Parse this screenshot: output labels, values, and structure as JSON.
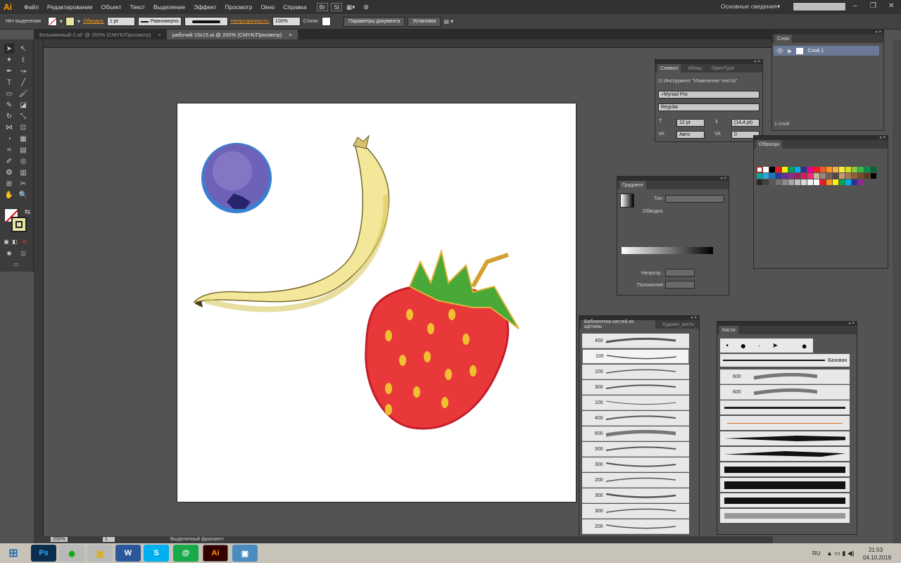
{
  "app": {
    "logo": "Ai",
    "workspace": "Основные сведения"
  },
  "menu": [
    "Файл",
    "Редактирование",
    "Объект",
    "Текст",
    "Выделение",
    "Эффект",
    "Просмотр",
    "Окно",
    "Справка"
  ],
  "menu_icons": [
    "Br",
    "St"
  ],
  "control_bar": {
    "selection_label": "Нет выделения",
    "stroke_label": "Обводка:",
    "stroke_weight": "1 pt",
    "profile": "Равномерно",
    "opacity_label": "Непрозрачность:",
    "opacity_value": "100%",
    "styles_label": "Стили:",
    "doc_params_button": "Параметры документа",
    "settings_button": "Установки"
  },
  "tabs": [
    {
      "label": "Безымянный-2.ai* @ 200% (CMYK/Просмотр)",
      "close": "×",
      "active": false
    },
    {
      "label": "рабочий 15х15.ai @ 200% (CMYK/Просмотр)",
      "close": "×",
      "active": true
    }
  ],
  "layers_panel": {
    "title": "Слои",
    "layer_name": "Слой 1",
    "footer": "1 слой"
  },
  "character_panel": {
    "tabs": [
      "Символ",
      "Абзац",
      "OpenType"
    ],
    "touch_tool": "Инструмент \"Изменение текста\"",
    "font_family": "Myriad Pro",
    "font_style": "Regular",
    "font_size": "12 pt",
    "leading": "(14,4 pt)",
    "kerning": "Авто",
    "tracking": "0"
  },
  "swatches_panel": {
    "title": "Образцы"
  },
  "gradient_panel": {
    "title": "Градиент",
    "type_label": "Тип:",
    "stroke_label": "Обводка:",
    "opacity_label": "Непрозр.:",
    "position_label": "Положение:"
  },
  "brush_library_panel": {
    "tabs": [
      "Библиотека кистей из щетины",
      "Художн_кисть"
    ],
    "rows": [
      "450",
      "100",
      "100",
      "300",
      "100",
      "400",
      "600",
      "300",
      "300",
      "200",
      "300",
      "300",
      "200"
    ]
  },
  "brushes_panel": {
    "title": "Кисти",
    "basic_label": "Базовая",
    "rows": [
      "600",
      "600"
    ]
  },
  "status": {
    "zoom": "200%",
    "page": "1",
    "tool": "Выделенный фрагмент"
  },
  "taskbar": {
    "apps": [
      "Ps",
      "Chrome",
      "Files",
      "W",
      "S",
      "@",
      "Ai",
      "Img"
    ],
    "lang": "RU",
    "time": "21:53",
    "date": "04.10.2019"
  },
  "colors": {
    "accent": "#f79a20",
    "panel": "#535353",
    "dark": "#323232"
  }
}
